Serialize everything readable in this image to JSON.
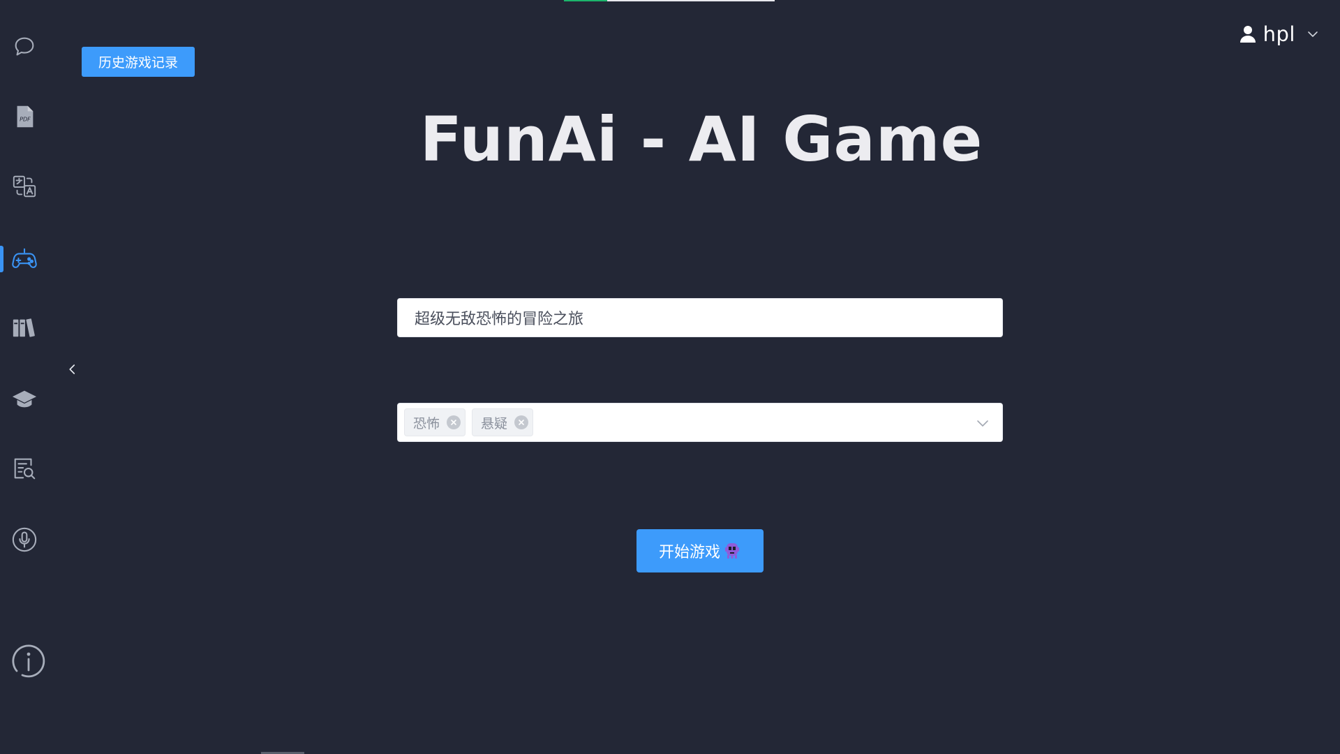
{
  "header": {
    "history_button": "历史游戏记录",
    "user_name": "hpl"
  },
  "main": {
    "title": "FunAi - AI Game",
    "theme_input_value": "超级无敌恐怖的冒险之旅",
    "tags": [
      "恐怖",
      "悬疑"
    ],
    "start_button": "开始游戏"
  },
  "sidebar": {
    "items": [
      {
        "icon": "chat-bubble-icon"
      },
      {
        "icon": "pdf-icon"
      },
      {
        "icon": "translate-icon"
      },
      {
        "icon": "gamepad-icon",
        "active": true
      },
      {
        "icon": "library-icon"
      },
      {
        "icon": "graduation-cap-icon"
      },
      {
        "icon": "document-search-icon"
      },
      {
        "icon": "microphone-icon"
      },
      {
        "icon": "info-icon"
      }
    ],
    "collapse_icon": "chevron-left-icon"
  },
  "colors": {
    "background": "#232736",
    "accent": "#3d9bfb",
    "active_nav": "#3a94f5",
    "icon_gray": "#a7adba"
  }
}
